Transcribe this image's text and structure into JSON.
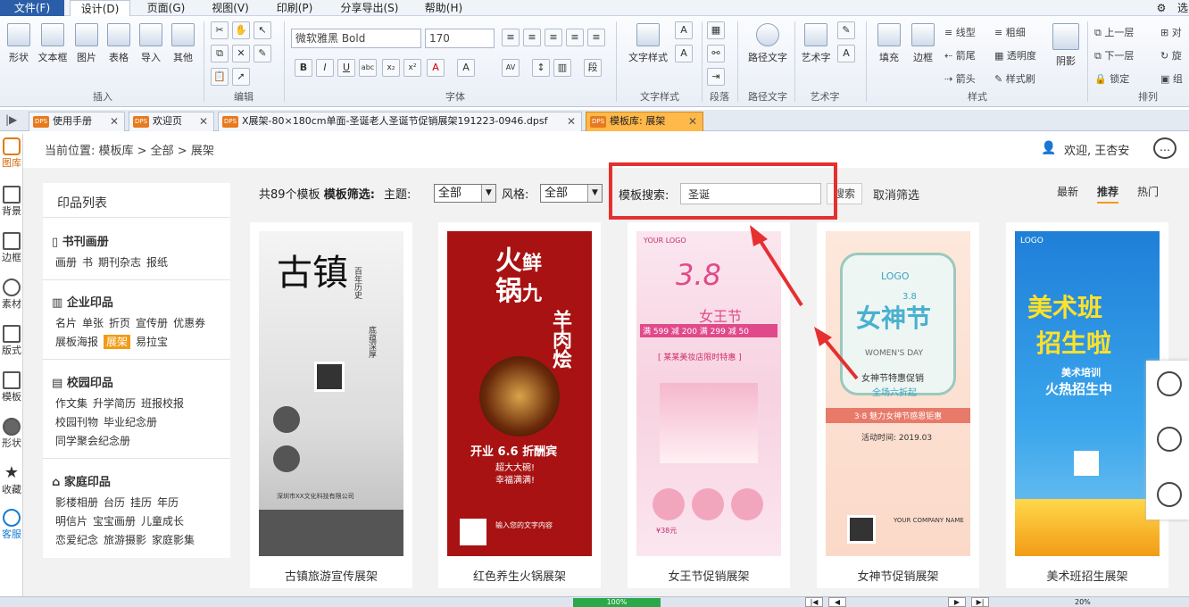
{
  "menu": {
    "items": [
      "文件(F)",
      "设计(D)",
      "页面(G)",
      "视图(V)",
      "印刷(P)",
      "分享导出(S)",
      "帮助(H)"
    ],
    "right_label": "选"
  },
  "ribbon": {
    "insert_buttons": [
      "形状",
      "文本框",
      "图片",
      "表格",
      "导入",
      "其他"
    ],
    "insert_group": "插入",
    "edit_group": "编辑",
    "font_name": "微软雅黑 Bold",
    "font_size": "170",
    "font_group": "字体",
    "text_style_label": "文字样式",
    "text_style_group": "文字样式",
    "paragraph_group": "段落",
    "path_text_label": "路径文字",
    "path_text_group": "路径文字",
    "art_text_label": "艺术字",
    "art_text_group": "艺术字",
    "style_buttons": [
      "填充",
      "边框"
    ],
    "style_options": [
      "线型",
      "箭尾",
      "箭头",
      "粗细",
      "透明度",
      "样式刷"
    ],
    "shadow_label": "阴影",
    "style_group": "样式",
    "arrange_options": [
      "上一层",
      "下一层",
      "锁定"
    ],
    "arrange_right": [
      "对",
      "旋",
      "组"
    ],
    "arrange_group": "排列"
  },
  "tabs": [
    {
      "label": "使用手册",
      "icon": "DPS"
    },
    {
      "label": "欢迎页",
      "icon": "DPS"
    },
    {
      "label": "X展架-80×180cm单面-圣诞老人圣诞节促销展架191223-0946.dpsf",
      "icon": "DPS"
    },
    {
      "label": "模板库: 展架",
      "icon": "DPS"
    }
  ],
  "leftbar": [
    "图库",
    "背景",
    "边框",
    "素材",
    "版式",
    "模板",
    "形状",
    "收藏",
    "客服"
  ],
  "breadcrumb": "当前位置: 模板库 > 全部 > 展架",
  "welcome": "欢迎, 王杏安",
  "category_panel": {
    "title": "印品列表",
    "sections": [
      {
        "title": "书刊画册",
        "items": [
          "画册",
          "书",
          "期刊杂志",
          "报纸"
        ]
      },
      {
        "title": "企业印品",
        "items": [
          "名片",
          "单张",
          "折页",
          "宣传册",
          "优惠券"
        ],
        "items2": [
          "展板海报",
          "展架",
          "易拉宝"
        ]
      },
      {
        "title": "校园印品",
        "items": [
          "作文集",
          "升学简历",
          "班报校报"
        ],
        "items2": [
          "校园刊物",
          "毕业纪念册"
        ],
        "items3": [
          "同学聚会纪念册"
        ]
      },
      {
        "title": "家庭印品",
        "items": [
          "影楼相册",
          "台历",
          "挂历",
          "年历"
        ],
        "items2": [
          "明信片",
          "宝宝画册",
          "儿童成长"
        ],
        "items3": [
          "恋爱纪念",
          "旅游摄影",
          "家庭影集"
        ]
      }
    ],
    "selected_item": "展架"
  },
  "filter": {
    "count_text": "共89个模板",
    "filter_label": "模板筛选:",
    "theme_label": "主题:",
    "theme_value": "全部",
    "style_label": "风格:",
    "style_value": "全部",
    "search_label": "模板搜索:",
    "search_value": "圣诞",
    "search_button": "搜索",
    "cancel": "取消筛选"
  },
  "sort": [
    "最新",
    "推荐",
    "热门"
  ],
  "sort_active": "推荐",
  "cards": [
    {
      "name": "古镇旅游宣传展架"
    },
    {
      "name": "红色养生火锅展架"
    },
    {
      "name": "女王节促销展架"
    },
    {
      "name": "女神节促销展架"
    },
    {
      "name": "美术班招生展架"
    }
  ],
  "posters": {
    "p1": {
      "title": "古镇",
      "side": "百年历史",
      "side2": "底蕴深厚",
      "company": "深圳市XX文化科技有限公司"
    },
    "p2": {
      "title1": "火",
      "title2": "锅",
      "title3": "鲜",
      "title4": "九",
      "title5": "羊",
      "title6": "肉",
      "title7": "烩",
      "promo": "开业 6.6 折酬宾",
      "promo2": "超大大碗!",
      "promo3": "幸福满满!",
      "input": "输入您的文字内容"
    },
    "p3": {
      "logo": "YOUR LOGO",
      "day": "3.8",
      "title": "女王节",
      "deal": "满 599 减 200 满 299 减 50",
      "band": "[ 某某美妆店限时特惠 ]",
      "price": "¥38元"
    },
    "p4": {
      "logo": "LOGO",
      "title": "女神节",
      "date": "3.8",
      "sub": "WOMEN'S DAY",
      "promo": "女神节特惠促销",
      "discount": "全场六折起",
      "band": "3·8 魅力女神节感恩钜惠",
      "time": "活动时间: 2019.03",
      "company": "YOUR COMPANY NAME"
    },
    "p5": {
      "logo": "LOGO",
      "title1": "美术班",
      "title2": "招生啦",
      "band": "美术培训",
      "band2": "火热招生中"
    }
  },
  "statusbar": {
    "zoom": "100%",
    "zoom2": "20%"
  }
}
